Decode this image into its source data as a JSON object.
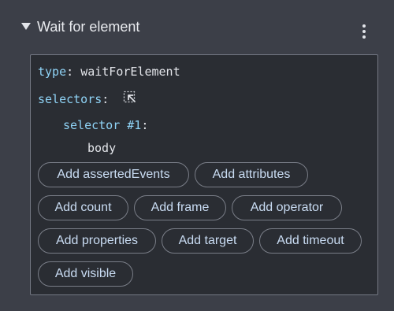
{
  "header": {
    "title": "Wait for element",
    "toggle_icon": "caret-down-icon",
    "menu_icon": "kebab-menu-icon"
  },
  "step": {
    "type_key": "type",
    "type_value": "waitForElement",
    "selectors_key": "selectors",
    "selector_picker_icon": "element-picker-icon",
    "selector1_key": "selector #1",
    "selector1_value": "body"
  },
  "colon": ":",
  "add_buttons": [
    "Add assertedEvents",
    "Add attributes",
    "Add count",
    "Add frame",
    "Add operator",
    "Add properties",
    "Add target",
    "Add timeout",
    "Add visible"
  ],
  "colors": {
    "background": "#3c3f48",
    "panel": "#2a2d33",
    "key": "#8fd3f6",
    "chip_text": "#c9dcf3",
    "chip_border": "#7a7e88"
  }
}
